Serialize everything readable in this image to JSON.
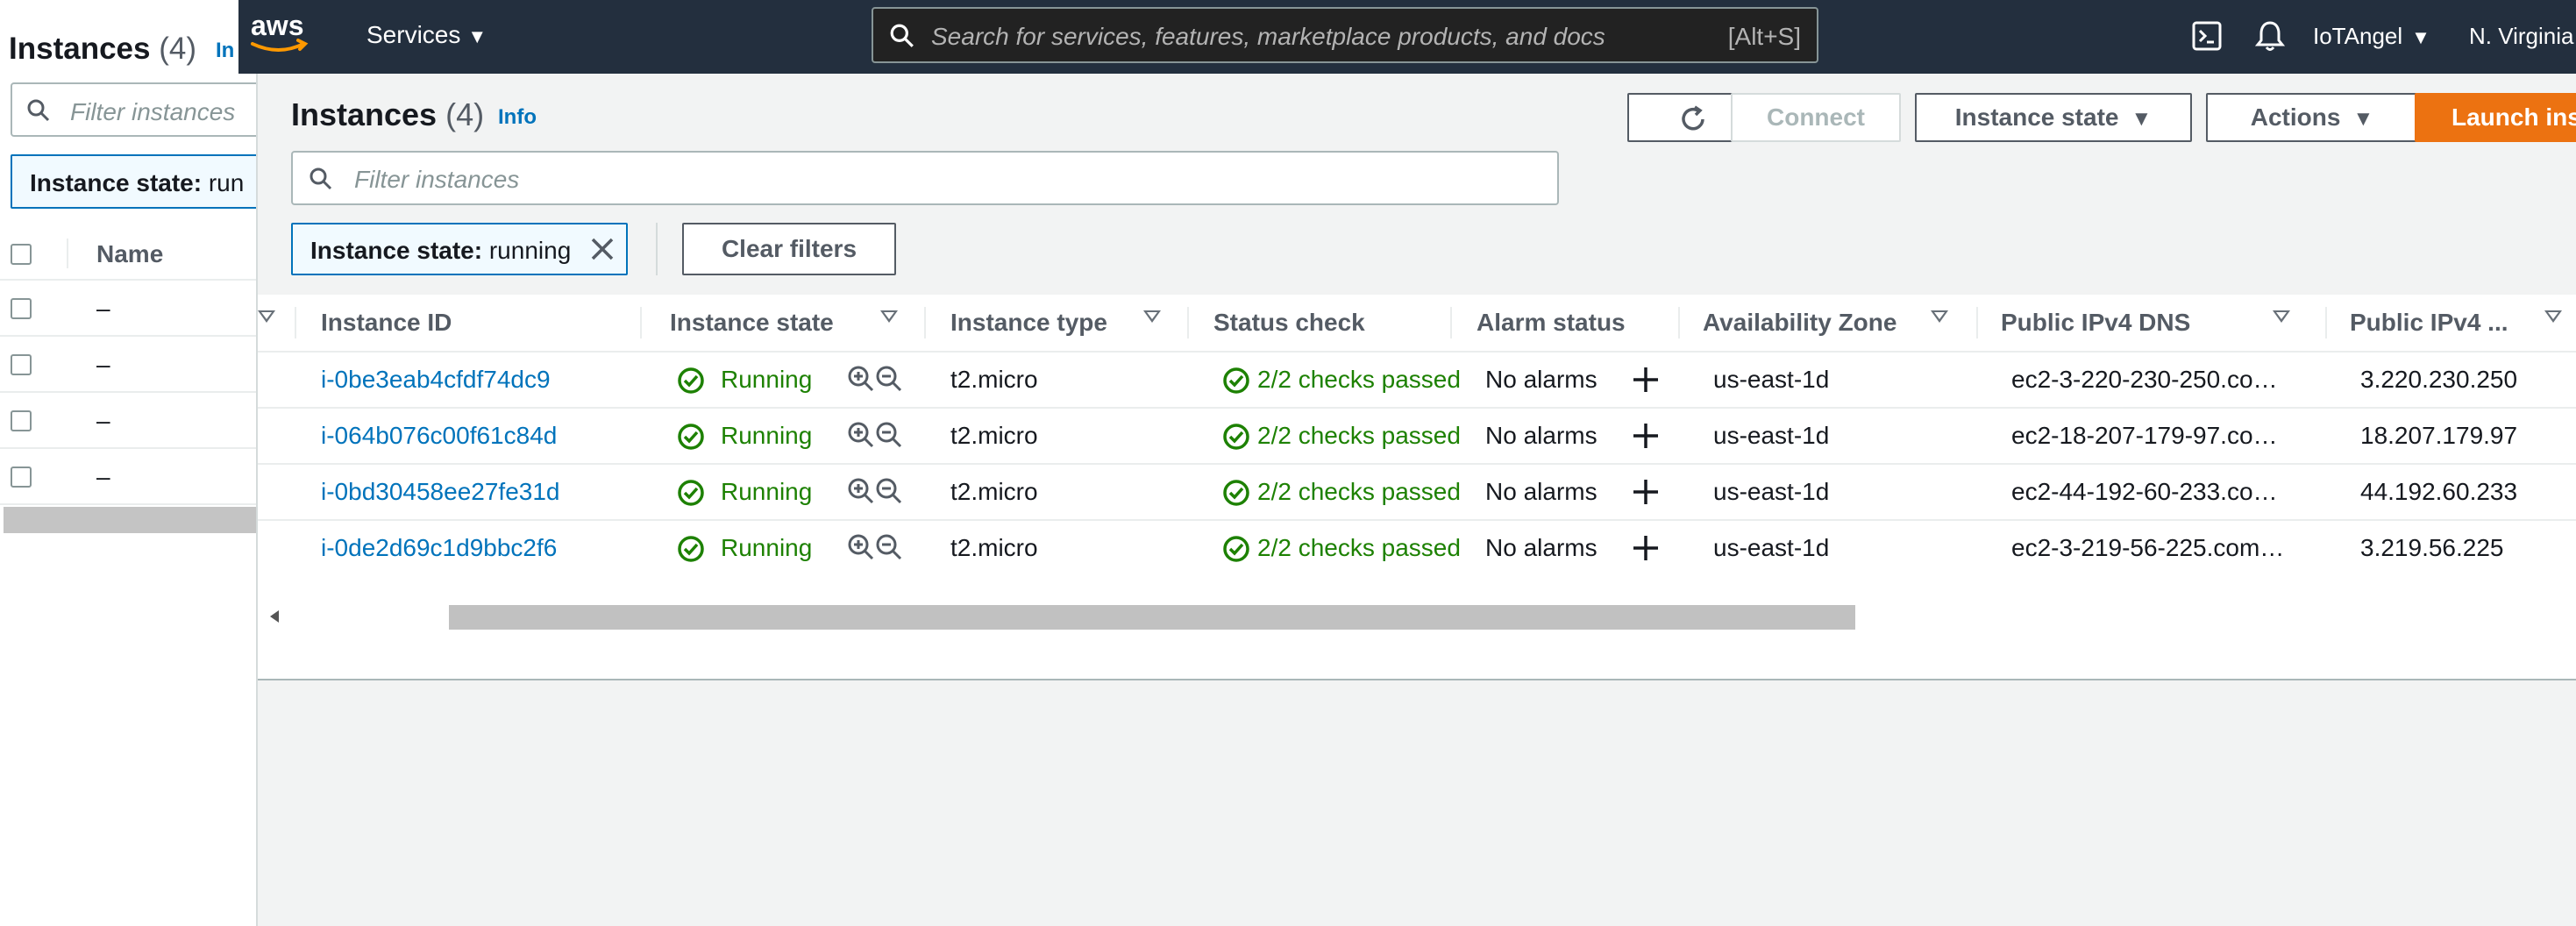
{
  "left_panel": {
    "title": "Instances",
    "count": "(4)",
    "info": "In",
    "search_placeholder": "Filter instances",
    "filter_token_key": "Instance state:",
    "filter_token_value": "run",
    "column_name": "Name",
    "rows": [
      "–",
      "–",
      "–",
      "–"
    ]
  },
  "nav": {
    "logo_text": "aws",
    "services": "Services",
    "search_placeholder": "Search for services, features, marketplace products, and docs",
    "search_shortcut": "[Alt+S]",
    "user": "IoTAngel",
    "region": "N. Virginia"
  },
  "main": {
    "title": "Instances",
    "count": "(4)",
    "info": "Info",
    "buttons": {
      "connect": "Connect",
      "instance_state": "Instance state",
      "actions": "Actions",
      "launch": "Launch ins"
    },
    "search_placeholder": "Filter instances",
    "filter_token_key": "Instance state:",
    "filter_token_value": "running",
    "clear_filters": "Clear filters",
    "columns": {
      "instance_id": "Instance ID",
      "instance_state": "Instance state",
      "instance_type": "Instance type",
      "status_check": "Status check",
      "alarm_status": "Alarm status",
      "availability_zone": "Availability Zone",
      "public_dns": "Public IPv4 DNS",
      "public_ip": "Public IPv4 ..."
    },
    "rows": [
      {
        "id": "i-0be3eab4cfdf74dc9",
        "state": "Running",
        "type": "t2.micro",
        "status": "2/2 checks passed",
        "alarm": "No alarms",
        "az": "us-east-1d",
        "dns": "ec2-3-220-230-250.co…",
        "ip": "3.220.230.250"
      },
      {
        "id": "i-064b076c00f61c84d",
        "state": "Running",
        "type": "t2.micro",
        "status": "2/2 checks passed",
        "alarm": "No alarms",
        "az": "us-east-1d",
        "dns": "ec2-18-207-179-97.co…",
        "ip": "18.207.179.97"
      },
      {
        "id": "i-0bd30458ee27fe31d",
        "state": "Running",
        "type": "t2.micro",
        "status": "2/2 checks passed",
        "alarm": "No alarms",
        "az": "us-east-1d",
        "dns": "ec2-44-192-60-233.co…",
        "ip": "44.192.60.233"
      },
      {
        "id": "i-0de2d69c1d9bbc2f6",
        "state": "Running",
        "type": "t2.micro",
        "status": "2/2 checks passed",
        "alarm": "No alarms",
        "az": "us-east-1d",
        "dns": "ec2-3-219-56-225.com…",
        "ip": "3.219.56.225"
      }
    ]
  },
  "colors": {
    "nav_bg": "#232f3e",
    "link": "#0073bb",
    "running_green": "#1d8102",
    "launch_orange": "#ec7211"
  }
}
